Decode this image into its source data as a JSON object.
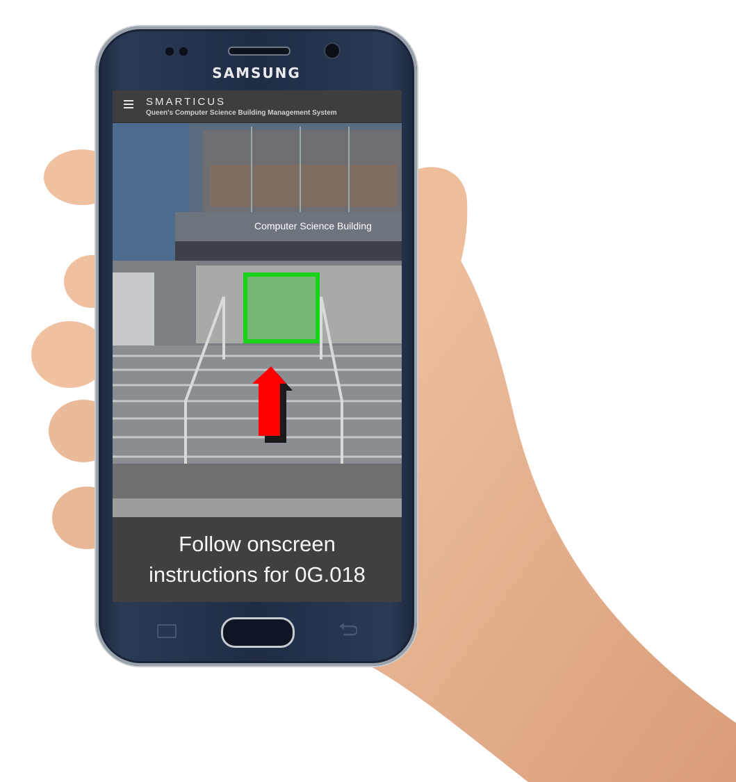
{
  "device": {
    "brand": "SAMSUNG",
    "brand_icon": "samsung-wordmark"
  },
  "app": {
    "title": "SMARTICUS",
    "subtitle": "Queen's Computer Science Building Management System",
    "menu_icon": "hamburger-menu-icon"
  },
  "scene": {
    "building_sign": "Computer Science Building",
    "target_highlight_color": "#19d319",
    "arrow_color": "#ff0000",
    "arrow_icon": "up-arrow-icon"
  },
  "caption": {
    "line1": "Follow onscreen",
    "line2": "instructions for 0G.018"
  }
}
